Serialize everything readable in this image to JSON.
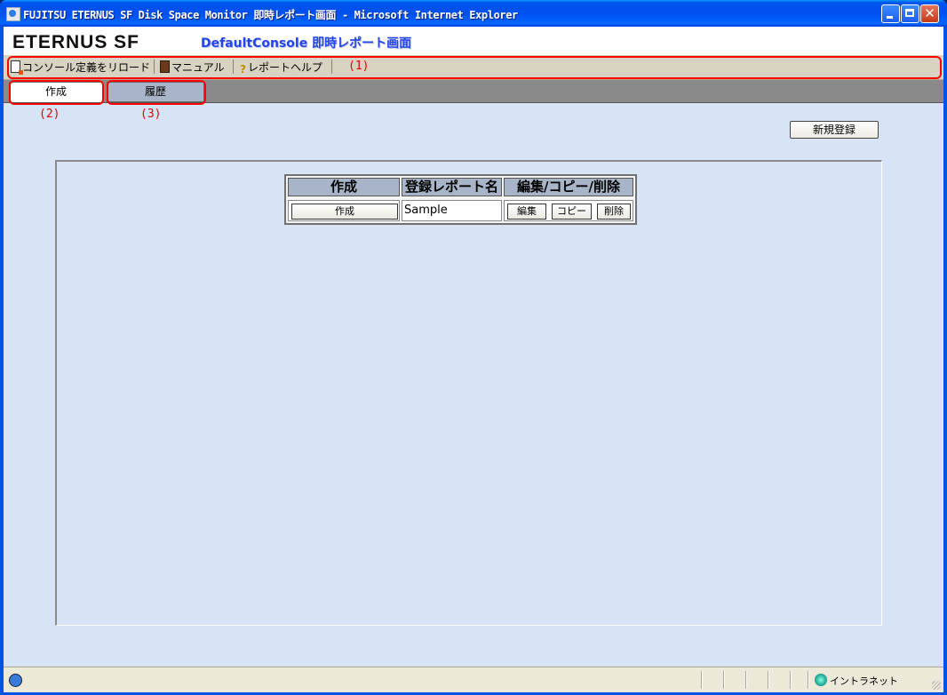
{
  "window": {
    "title": "FUJITSU ETERNUS SF Disk Space Monitor 即時レポート画面 - Microsoft Internet Explorer"
  },
  "header": {
    "logo": "ETERNUS SF",
    "screen_title": "DefaultConsole 即時レポート画面"
  },
  "toolbar": {
    "items": [
      {
        "label": "コンソール定義をリロード",
        "icon": "reload-icon"
      },
      {
        "label": "マニュアル",
        "icon": "manual-book-icon"
      },
      {
        "label": "レポートヘルプ",
        "icon": "help-icon"
      }
    ]
  },
  "tabs": [
    {
      "label": "作成",
      "active": true
    },
    {
      "label": "履歴",
      "active": false
    }
  ],
  "annotations": {
    "toolbar": "(1)",
    "tab_create": "(2)",
    "tab_history": "(3)"
  },
  "actions": {
    "new_register": "新規登録"
  },
  "report_table": {
    "headers": [
      "作成",
      "登録レポート名",
      "編集/コピー/削除"
    ],
    "rows": [
      {
        "create_button": "作成",
        "name": "Sample",
        "edit": "編集",
        "copy": "コピー",
        "delete": "削除"
      }
    ]
  },
  "statusbar": {
    "zone": "イントラネット"
  },
  "colors": {
    "title_bar": "#0054e3",
    "tab_active": "#ffffff",
    "tab_inactive": "#a8b4c8",
    "table_header": "#a8b4c8",
    "annotation": "#ff0000",
    "content_bg": "#d6e4f5"
  }
}
